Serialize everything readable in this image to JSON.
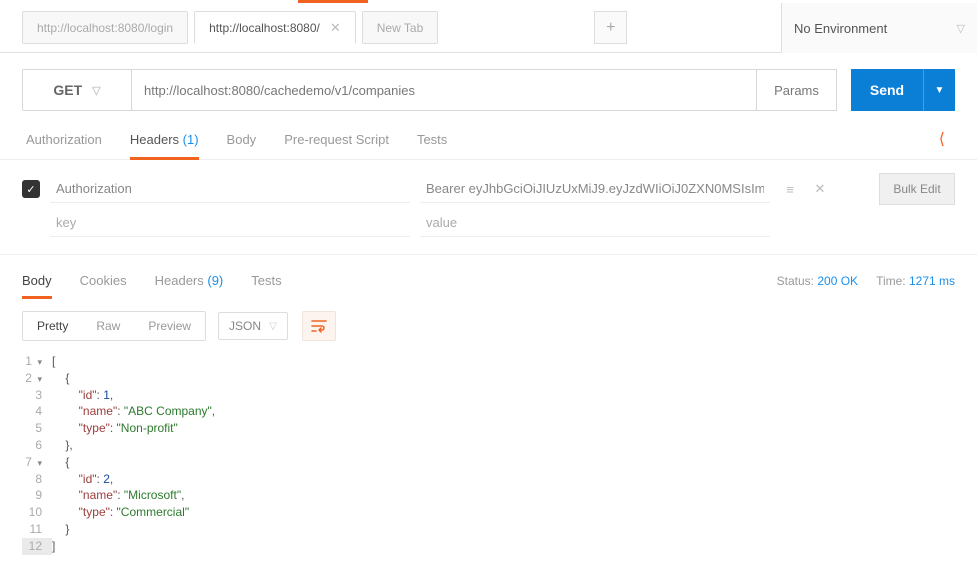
{
  "tabs": [
    {
      "label": "http://localhost:8080/login",
      "active": false
    },
    {
      "label": "http://localhost:8080/",
      "active": true
    },
    {
      "label": "New Tab",
      "active": false
    }
  ],
  "environment": {
    "label": "No Environment"
  },
  "request": {
    "method": "GET",
    "url": "http://localhost:8080/cachedemo/v1/companies",
    "params_label": "Params",
    "send_label": "Send"
  },
  "req_tabs": {
    "authorization": "Authorization",
    "headers": "Headers",
    "headers_count": "(1)",
    "body": "Body",
    "prerequest": "Pre-request Script",
    "tests": "Tests"
  },
  "headers": {
    "row": {
      "key": "Authorization",
      "value": "Bearer eyJhbGciOiJIUzUxMiJ9.eyJzdWIiOiJ0ZXN0MSIsIm'"
    },
    "placeholder_key": "key",
    "placeholder_value": "value",
    "bulk_edit": "Bulk Edit"
  },
  "resp_tabs": {
    "body": "Body",
    "cookies": "Cookies",
    "headers": "Headers",
    "headers_count": "(9)",
    "tests": "Tests"
  },
  "resp_meta": {
    "status_label": "Status:",
    "status_value": "200 OK",
    "time_label": "Time:",
    "time_value": "1271 ms"
  },
  "view": {
    "pretty": "Pretty",
    "raw": "Raw",
    "preview": "Preview",
    "format": "JSON"
  },
  "code_lines": [
    {
      "n": 1,
      "fold": true,
      "tokens": [
        {
          "t": "[",
          "c": "punc"
        }
      ]
    },
    {
      "n": 2,
      "fold": true,
      "indent": 1,
      "tokens": [
        {
          "t": "{",
          "c": "punc"
        }
      ]
    },
    {
      "n": 3,
      "indent": 2,
      "tokens": [
        {
          "t": "\"id\"",
          "c": "key"
        },
        {
          "t": ": ",
          "c": "punc"
        },
        {
          "t": "1",
          "c": "num"
        },
        {
          "t": ",",
          "c": "punc"
        }
      ]
    },
    {
      "n": 4,
      "indent": 2,
      "tokens": [
        {
          "t": "\"name\"",
          "c": "key"
        },
        {
          "t": ": ",
          "c": "punc"
        },
        {
          "t": "\"ABC Company\"",
          "c": "str"
        },
        {
          "t": ",",
          "c": "punc"
        }
      ]
    },
    {
      "n": 5,
      "indent": 2,
      "tokens": [
        {
          "t": "\"type\"",
          "c": "key"
        },
        {
          "t": ": ",
          "c": "punc"
        },
        {
          "t": "\"Non-profit\"",
          "c": "str"
        }
      ]
    },
    {
      "n": 6,
      "indent": 1,
      "tokens": [
        {
          "t": "},",
          "c": "punc"
        }
      ]
    },
    {
      "n": 7,
      "fold": true,
      "indent": 1,
      "tokens": [
        {
          "t": "{",
          "c": "punc"
        }
      ]
    },
    {
      "n": 8,
      "indent": 2,
      "tokens": [
        {
          "t": "\"id\"",
          "c": "key"
        },
        {
          "t": ": ",
          "c": "punc"
        },
        {
          "t": "2",
          "c": "num"
        },
        {
          "t": ",",
          "c": "punc"
        }
      ]
    },
    {
      "n": 9,
      "indent": 2,
      "tokens": [
        {
          "t": "\"name\"",
          "c": "key"
        },
        {
          "t": ": ",
          "c": "punc"
        },
        {
          "t": "\"Microsoft\"",
          "c": "str"
        },
        {
          "t": ",",
          "c": "punc"
        }
      ]
    },
    {
      "n": 10,
      "indent": 2,
      "tokens": [
        {
          "t": "\"type\"",
          "c": "key"
        },
        {
          "t": ": ",
          "c": "punc"
        },
        {
          "t": "\"Commercial\"",
          "c": "str"
        }
      ]
    },
    {
      "n": 11,
      "indent": 1,
      "tokens": [
        {
          "t": "}",
          "c": "punc"
        }
      ]
    },
    {
      "n": 12,
      "hl": true,
      "tokens": [
        {
          "t": "]",
          "c": "punc"
        }
      ]
    }
  ]
}
